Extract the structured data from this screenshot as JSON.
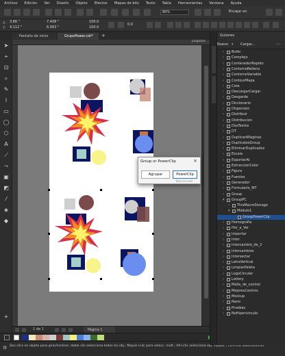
{
  "menubar": {
    "items": [
      "Archivo",
      "Edición",
      "Ver",
      "Diseño",
      "Objeto",
      "Efectos",
      "Mapas de bits",
      "Texto",
      "Tabla",
      "Herramientas",
      "Ventana",
      "Ayuda"
    ]
  },
  "toolbar": {
    "zoom": "80%",
    "snap_label": "Encajar en"
  },
  "propbar": {
    "x": "3.86 \"",
    "y": "4.112 \"",
    "width": "7.408 \"",
    "height": "6.063 \"",
    "scale_w": "100.0",
    "scale_h": "100.0",
    "angle": "0.0"
  },
  "tabs": {
    "home": "Pantalla de inicio",
    "doc": "GrupoPower.cdr*"
  },
  "ruler": {
    "units": "pulgadas"
  },
  "panel": {
    "title": "Guiones",
    "new_label": "Nuevo",
    "load_label": "Cargar..."
  },
  "tree": [
    {
      "label": "Bufer",
      "indent": 0,
      "chev": ">"
    },
    {
      "label": "Complejo",
      "indent": 0,
      "chev": ">"
    },
    {
      "label": "ContenedorRapido",
      "indent": 0,
      "chev": ">"
    },
    {
      "label": "ContornoRelleno",
      "indent": 0,
      "chev": ">"
    },
    {
      "label": "ContornoVariable",
      "indent": 0,
      "chev": ">"
    },
    {
      "label": "ContourMapa",
      "indent": 0,
      "chev": ">"
    },
    {
      "label": "Cota",
      "indent": 0,
      "chev": ">"
    },
    {
      "label": "DescargarCargar",
      "indent": 0,
      "chev": ">"
    },
    {
      "label": "Desgarde",
      "indent": 0,
      "chev": ">"
    },
    {
      "label": "Diccionario",
      "indent": 0,
      "chev": ">"
    },
    {
      "label": "Dispersion",
      "indent": 0,
      "chev": ">"
    },
    {
      "label": "Distribuir",
      "indent": 0,
      "chev": ">"
    },
    {
      "label": "Distribucion",
      "indent": 0,
      "chev": ">"
    },
    {
      "label": "DosTextos",
      "indent": 0,
      "chev": ">"
    },
    {
      "label": "DT",
      "indent": 0,
      "chev": ">"
    },
    {
      "label": "DuplicarAPaginas",
      "indent": 0,
      "chev": ">"
    },
    {
      "label": "DuplicatesGroup",
      "indent": 0,
      "chev": ">"
    },
    {
      "label": "EliminarDuplicados",
      "indent": 0,
      "chev": ">"
    },
    {
      "label": "Escala",
      "indent": 0,
      "chev": ">"
    },
    {
      "label": "ExportarAI",
      "indent": 0,
      "chev": ">"
    },
    {
      "label": "ExtraccionColor",
      "indent": 0,
      "chev": ">"
    },
    {
      "label": "Figura",
      "indent": 0,
      "chev": ">"
    },
    {
      "label": "Fuentes",
      "indent": 0,
      "chev": ">"
    },
    {
      "label": "Generador",
      "indent": 0,
      "chev": ">"
    },
    {
      "label": "Formulario_MT",
      "indent": 0,
      "chev": ">"
    },
    {
      "label": "Group",
      "indent": 0,
      "chev": ">"
    },
    {
      "label": "GroupPC",
      "indent": 0,
      "chev": "v"
    },
    {
      "label": "ThisMacroStorage",
      "indent": 1,
      "chev": ">"
    },
    {
      "label": "Módulo1",
      "indent": 1,
      "chev": "v"
    },
    {
      "label": "GroupPowerClip",
      "indent": 2,
      "chev": "",
      "selected": true
    },
    {
      "label": "Homografia",
      "indent": 0,
      "chev": ">"
    },
    {
      "label": "Hor_a_Ver",
      "indent": 0,
      "chev": ">"
    },
    {
      "label": "Importar",
      "indent": 0,
      "chev": ">"
    },
    {
      "label": "Inter",
      "indent": 0,
      "chev": ">"
    },
    {
      "label": "Intercambio_de_2",
      "indent": 0,
      "chev": ">"
    },
    {
      "label": "Intercambios",
      "indent": 0,
      "chev": ">"
    },
    {
      "label": "Intersectar",
      "indent": 0,
      "chev": ">"
    },
    {
      "label": "LetraVertical",
      "indent": 0,
      "chev": ">"
    },
    {
      "label": "LimpiarPaleta",
      "indent": 0,
      "chev": ">"
    },
    {
      "label": "LogoCircular",
      "indent": 0,
      "chev": ">"
    },
    {
      "label": "Lottery",
      "indent": 0,
      "chev": ">"
    },
    {
      "label": "Malla_de_control",
      "indent": 0,
      "chev": ">"
    },
    {
      "label": "MejoresCentros",
      "indent": 0,
      "chev": ">"
    },
    {
      "label": "Mockup",
      "indent": 0,
      "chev": ">"
    },
    {
      "label": "Nano",
      "indent": 0,
      "chev": ">"
    },
    {
      "label": "Pruebas",
      "indent": 0,
      "chev": ">"
    },
    {
      "label": "NoHipervinculo",
      "indent": 0,
      "chev": ">"
    }
  ],
  "dialog": {
    "title": "Group or PowerClip",
    "group_label": "Agrupar",
    "powerclip_label": "PowerClip",
    "hint": "Tecla la Lord"
  },
  "pagebar": {
    "page_info": "1  de  1",
    "page_tab": "Página 1"
  },
  "palette": {
    "colors": [
      "#1a2f8a",
      "#f2e9b4",
      "#c98a7a",
      "#d7b2a8",
      "#cfcfcf",
      "#7a3b36",
      "#a3c6c2",
      "#f7f07a",
      "#4a7fd6",
      "#8cb0f0",
      "#3a6b2a",
      "#bde07a"
    ]
  },
  "status": {
    "text": "Dos clics en objeto para girar/inclinar; doble clic selecciona todos los obj.; Mayús+clic para selecc. múlt.; Alt+clic selecciona obj. subyac.; Ctrl+clic selecciona en"
  },
  "colors": {
    "navy": "#0c1560",
    "rose": "#7c4a4a",
    "blue": "#6a8df0",
    "yellow": "#f7f48a",
    "teal": "#a3d0c8",
    "orange": "#c9733d",
    "accent": "#2f6fcc"
  }
}
